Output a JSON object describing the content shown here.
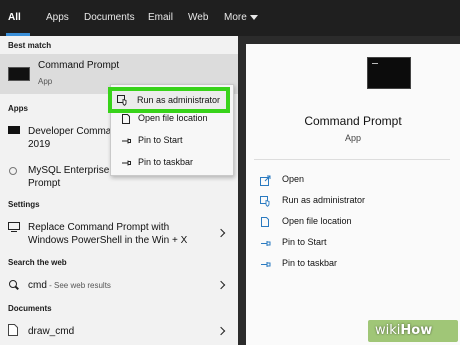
{
  "tabs": [
    "All",
    "Apps",
    "Documents",
    "Email",
    "Web",
    "More"
  ],
  "left": {
    "best_match_label": "Best match",
    "best": {
      "title": "Command Prompt",
      "subtitle": "App"
    },
    "apps_label": "Apps",
    "apps": [
      {
        "line1": "Developer Comma",
        "line2": "2019"
      },
      {
        "line1": "MySQL Enterprise",
        "line2": "Prompt"
      }
    ],
    "settings_label": "Settings",
    "setting": {
      "line1": "Replace Command Prompt with",
      "line2": "Windows PowerShell in the Win + X"
    },
    "web_label": "Search the web",
    "web": {
      "query": "cmd",
      "hint": " - See web results"
    },
    "documents_label": "Documents",
    "document": "draw_cmd"
  },
  "context_menu": [
    "Run as administrator",
    "Open file location",
    "Pin to Start",
    "Pin to taskbar"
  ],
  "preview": {
    "title": "Command Prompt",
    "subtitle": "App",
    "actions": [
      {
        "label": "Open",
        "icon": "open-icon"
      },
      {
        "label": "Run as administrator",
        "icon": "shield-icon"
      },
      {
        "label": "Open file location",
        "icon": "file-location-icon"
      },
      {
        "label": "Pin to Start",
        "icon": "pin-icon"
      },
      {
        "label": "Pin to taskbar",
        "icon": "pin-icon"
      }
    ]
  },
  "watermark": {
    "wiki": "wiki",
    "how": "How"
  },
  "colors": {
    "accent": "#3a8fd8",
    "highlight": "#38d31a"
  }
}
